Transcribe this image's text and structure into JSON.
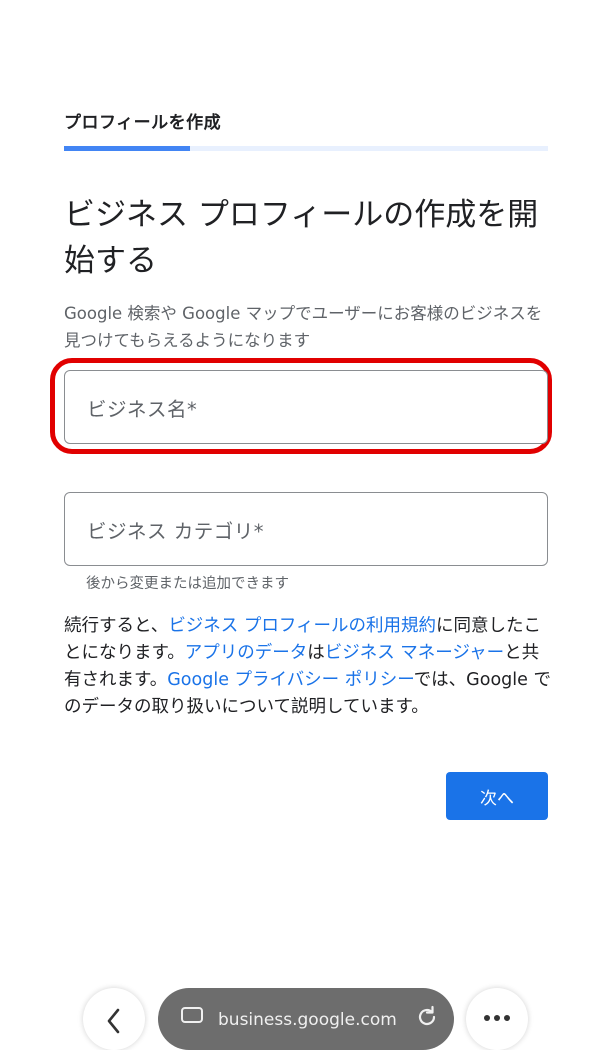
{
  "header": {
    "title": "プロフィールを作成",
    "progress_fraction": 0.26
  },
  "main": {
    "title": "ビジネス プロフィールの作成を開始する",
    "subtitle": "Google 検索や Google マップでユーザーにお客様のビジネスを見つけてもらえるようになります",
    "fields": {
      "business_name_placeholder": "ビジネス名*",
      "business_category_placeholder": "ビジネス カテゴリ*",
      "category_helper": "後から変更または追加できます"
    },
    "legal": {
      "t1": "続行すると、",
      "link_terms": "ビジネス プロフィールの利用規約",
      "t2": "に同意したことになります。",
      "link_app_data": "アプリのデータ",
      "t3": "は",
      "link_business_manager": "ビジネス マネージャー",
      "t4": "と共有されます。",
      "link_privacy": "Google プライバシー ポリシー",
      "t5": "では、Google でのデータの取り扱いについて説明しています。"
    },
    "next_label": "次へ"
  },
  "browser": {
    "url": "business.google.com",
    "icons": [
      "back-icon",
      "tab-icon",
      "reload-icon",
      "more-icon"
    ]
  },
  "colors": {
    "accent": "#1a73e8",
    "progress": "#4285f4",
    "highlight": "#e10000"
  }
}
